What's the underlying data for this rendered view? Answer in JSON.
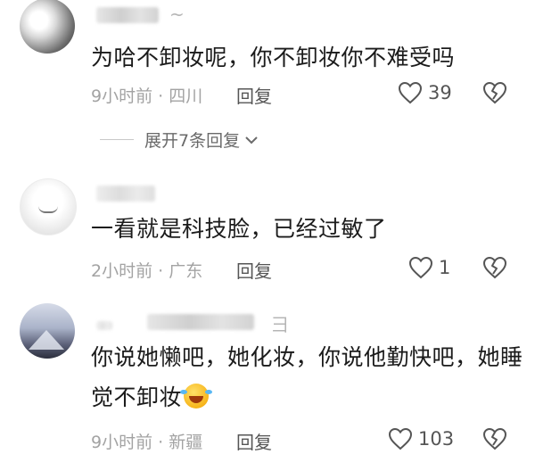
{
  "comments": [
    {
      "name_suffix": "~",
      "text_lines": [
        "为哈不卸妆呢，你不卸妆你不难受吗"
      ],
      "time": "9小时前",
      "location": "四川",
      "reply_label": "回复",
      "likes": "39",
      "expand_label": "展开7条回复"
    },
    {
      "name_suffix": "",
      "text_lines": [
        "一看就是科技脸，已经过敏了"
      ],
      "time": "2小时前",
      "location": "广东",
      "reply_label": "回复",
      "likes": "1"
    },
    {
      "name_suffix": "彐",
      "text_lines": [
        "你说她懒吧，她化妆，你说他勤快吧，她睡",
        "觉不卸妆"
      ],
      "time": "9小时前",
      "location": "新疆",
      "reply_label": "回复",
      "likes": "103",
      "emoji": "laughing-tears-emoji"
    }
  ],
  "separator": "·",
  "icons": {
    "like": "heart-outline-icon",
    "dislike": "broken-heart-icon",
    "expand": "chevron-down-icon"
  },
  "colors": {
    "text": "#1b1b1b",
    "meta": "#a3a3a3",
    "action": "#555555"
  }
}
